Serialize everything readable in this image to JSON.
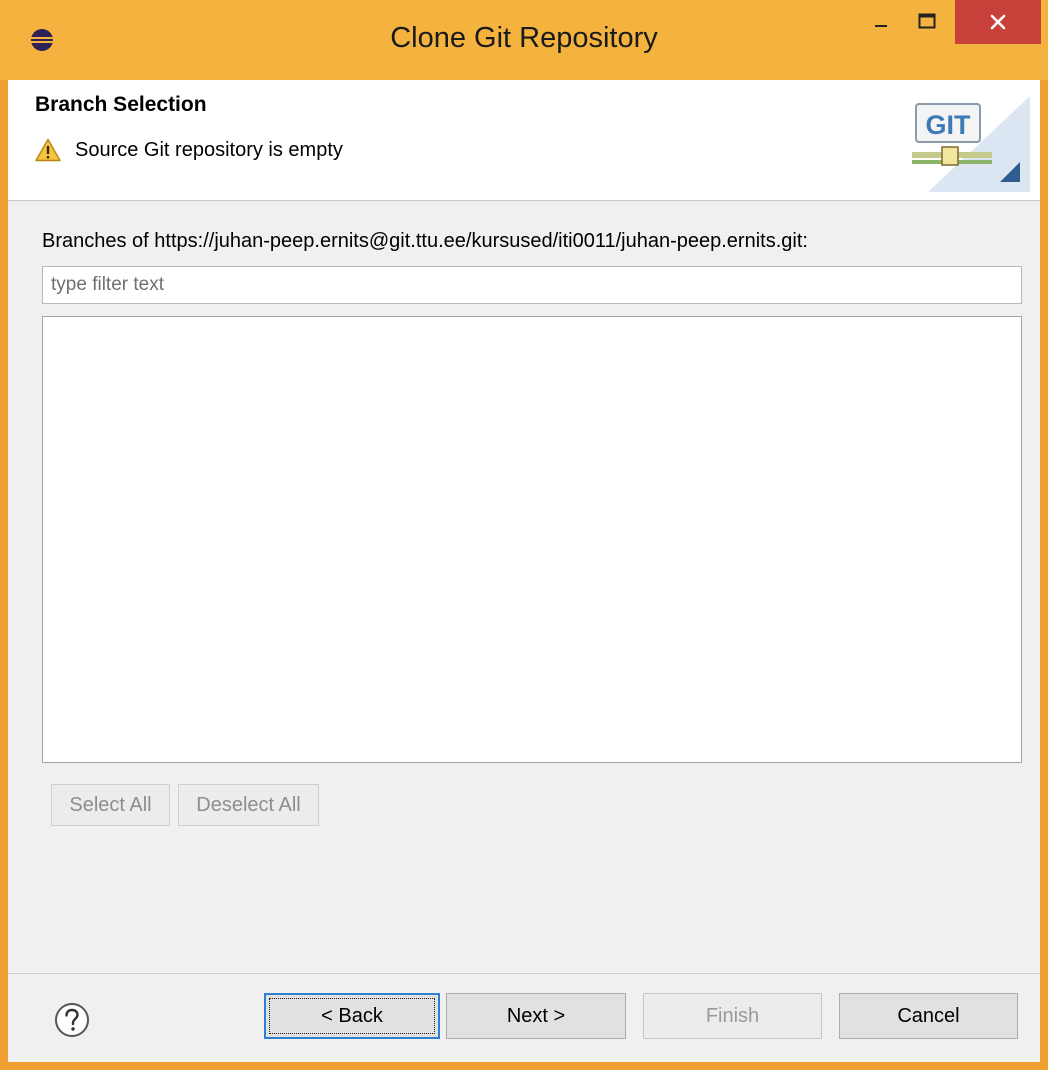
{
  "window": {
    "title": "Clone Git Repository"
  },
  "header": {
    "title": "Branch Selection",
    "message": "Source Git repository is empty",
    "logo_text": "GIT"
  },
  "branches": {
    "label": "Branches of https://juhan-peep.ernits@git.ttu.ee/kursused/iti0011/juhan-peep.ernits.git:",
    "filter_value": "",
    "filter_placeholder": "type filter text",
    "items": []
  },
  "selection_buttons": {
    "select_all": "Select All",
    "deselect_all": "Deselect All"
  },
  "footer": {
    "back": "< Back",
    "next": "Next >",
    "finish": "Finish",
    "cancel": "Cancel"
  },
  "colors": {
    "titlebar": "#f4b23e",
    "close_button": "#c7403a",
    "focus_border": "#2f7fcf"
  },
  "icons": {
    "app": "eclipse-icon",
    "warning": "warning-icon",
    "help": "help-icon",
    "minimize": "minimize-icon",
    "maximize": "maximize-icon",
    "close": "close-icon"
  }
}
